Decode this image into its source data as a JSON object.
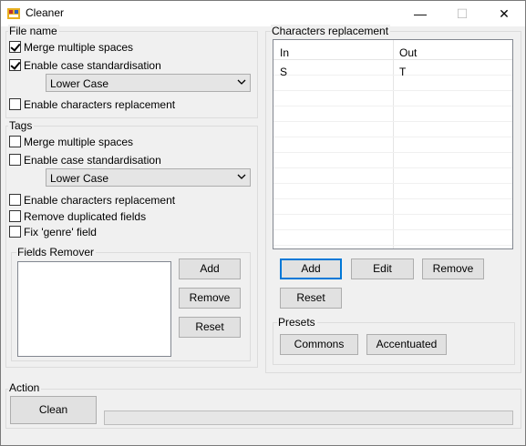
{
  "window": {
    "title": "Cleaner",
    "controls": [
      "—",
      "☐",
      "✕"
    ]
  },
  "file_name": {
    "label": "File name",
    "merge_spaces": {
      "label": "Merge multiple spaces",
      "checked": true
    },
    "case_std": {
      "label": "Enable case standardisation",
      "checked": true
    },
    "case_select": {
      "value": "Lower Case"
    },
    "char_replace": {
      "label": "Enable characters replacement",
      "checked": false
    }
  },
  "tags": {
    "label": "Tags",
    "merge_spaces": {
      "label": "Merge multiple spaces",
      "checked": false
    },
    "case_std": {
      "label": "Enable case standardisation",
      "checked": false
    },
    "case_select": {
      "value": "Lower Case"
    },
    "char_replace": {
      "label": "Enable characters replacement",
      "checked": false
    },
    "remove_dup": {
      "label": "Remove duplicated fields",
      "checked": false
    },
    "fix_genre": {
      "label": "Fix 'genre' field",
      "checked": false
    }
  },
  "fields_remover": {
    "label": "Fields Remover",
    "add": "Add",
    "remove": "Remove",
    "reset": "Reset"
  },
  "chars_replacement": {
    "label": "Characters replacement",
    "columns": [
      "In",
      "Out"
    ],
    "rows": [
      [
        "S",
        "T"
      ]
    ],
    "add": "Add",
    "edit": "Edit",
    "remove": "Remove",
    "reset": "Reset"
  },
  "presets": {
    "label": "Presets",
    "commons": "Commons",
    "accentuated": "Accentuated"
  },
  "action": {
    "label": "Action",
    "clean": "Clean",
    "progress": 0
  }
}
